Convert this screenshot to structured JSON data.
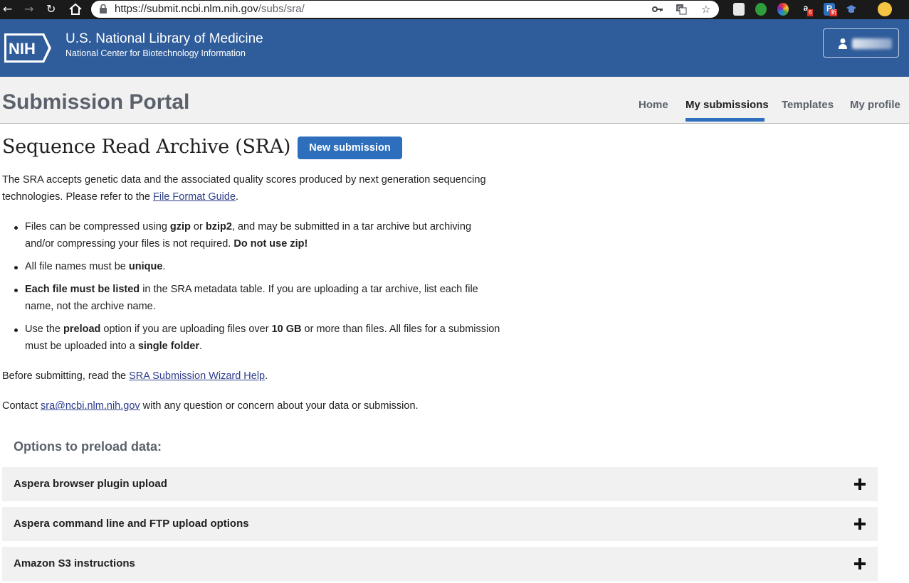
{
  "browser": {
    "url_host": "https://submit.ncbi.nlm.nih.gov",
    "url_path": "/subs/sra/",
    "ext_badge_a": "6",
    "ext_badge_p": "新"
  },
  "header": {
    "logo_text": "NIH",
    "title": "U.S. National Library of Medicine",
    "subtitle": "National Center for Biotechnology Information"
  },
  "portal": {
    "title": "Submission Portal",
    "nav": [
      {
        "label": "Home"
      },
      {
        "label": "My submissions"
      },
      {
        "label": "Templates"
      },
      {
        "label": "My profile"
      }
    ],
    "active_nav": "My submissions"
  },
  "main": {
    "heading": "Sequence Read Archive (SRA)",
    "new_submission": "New submission",
    "intro_1": "The SRA accepts genetic data and the associated quality scores produced by next generation sequencing",
    "intro_2_pre": "technologies. Please refer to the ",
    "intro_2_link": "File Format Guide",
    "intro_2_post": ".",
    "bullets": {
      "b1_a": "Files can be compressed using ",
      "b1_b": "gzip",
      "b1_c": " or ",
      "b1_d": "bzip2",
      "b1_e": ", and may be submitted in a tar archive but archiving",
      "b1_f": "and/or compressing your files is not required. ",
      "b1_g": "Do not use zip!",
      "b2_a": "All file names must be ",
      "b2_b": "unique",
      "b2_c": ".",
      "b3_a": "Each file must be listed",
      "b3_b": " in the SRA metadata table. If you are uploading a tar archive, list each file",
      "b3_c": "name, not the archive name.",
      "b4_a": "Use the ",
      "b4_b": "preload",
      "b4_c": " option if you are uploading files over ",
      "b4_d": "10 GB",
      "b4_e": " or more than files. All files for a submission",
      "b4_f": "must be uploaded into a ",
      "b4_g": "single folder",
      "b4_h": "."
    },
    "before_pre": "Before submitting, read the ",
    "before_link": "SRA Submission Wizard Help",
    "before_post": ".",
    "contact_pre": "Contact ",
    "contact_link": "sra@ncbi.nlm.nih.gov",
    "contact_post": " with any question or concern about your data or submission.",
    "options_title": "Options to preload data:",
    "accordions": [
      {
        "label": "Aspera browser plugin upload"
      },
      {
        "label": "Aspera command line and FTP upload options"
      },
      {
        "label": "Amazon S3 instructions"
      }
    ]
  },
  "colors": {
    "header_blue": "#2f5c9a",
    "button_blue": "#2d6fbd",
    "link": "#2d3d8b",
    "portal_gray": "#f1f1f1"
  }
}
